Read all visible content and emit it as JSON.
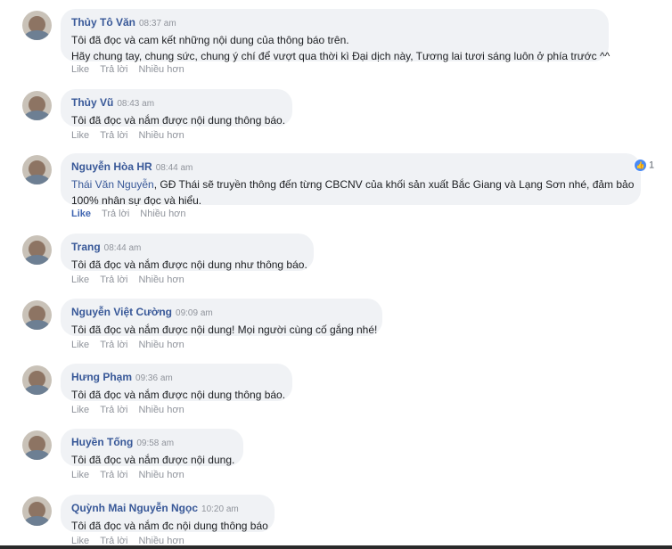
{
  "actions": {
    "like": "Like",
    "reply": "Trả lời",
    "more": "Nhiều hơn"
  },
  "comments": [
    {
      "author": "Thủy Tô Văn",
      "time": "08:37 am",
      "lines": [
        "Tôi đã đọc và cam kết những nội dung của thông báo trên.",
        "Hãy chung tay, chung sức, chung ý chí để vượt qua thời kì Đại dịch này, Tương lai tươi sáng luôn ở phía trước ^^"
      ]
    },
    {
      "author": "Thủy Vũ",
      "time": "08:43 am",
      "lines": [
        "Tôi đã đọc và nắm được nội dung thông báo."
      ]
    },
    {
      "author": "Nguyễn Hòa HR",
      "time": "08:44 am",
      "mention": "Thái Văn Nguyễn",
      "lines": [
        ", GĐ Thái sẽ truyền thông đến từng CBCNV của khối sản xuất Bắc Giang và Lạng Sơn nhé, đảm bảo",
        "100% nhân sự đọc và hiểu."
      ],
      "reaction_count": "1",
      "liked": true
    },
    {
      "author": "Trang",
      "time": "08:44 am",
      "lines": [
        "Tôi đã đọc và nắm được nội dung như thông báo."
      ]
    },
    {
      "author": "Nguyễn Việt Cường",
      "time": "09:09 am",
      "lines": [
        "Tôi đã đọc và nắm được nội dung! Mọi người cùng cố gắng nhé!"
      ]
    },
    {
      "author": "Hưng Phạm",
      "time": "09:36 am",
      "lines": [
        "Tôi đã đọc và nắm được nội dung thông báo."
      ]
    },
    {
      "author": "Huyền Tống",
      "time": "09:58 am",
      "lines": [
        "Tôi đã đọc và nắm được nội dung."
      ]
    },
    {
      "author": "Quỳnh Mai Nguyễn Ngọc",
      "time": "10:20 am",
      "lines": [
        "Tôi đã đọc và nắm đc nội dung thông báo"
      ]
    }
  ]
}
